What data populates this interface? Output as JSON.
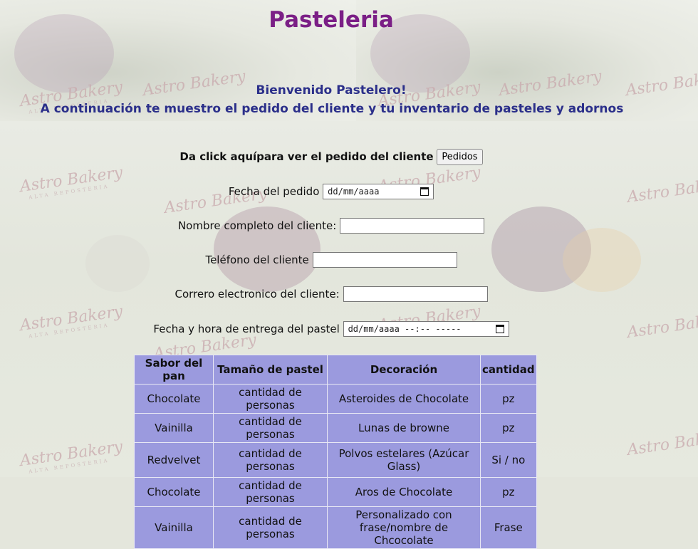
{
  "header": {
    "title": "Pasteleria",
    "welcome": "Bienvenido Pastelero!",
    "intro": "A continuación te muestro el pedido del cliente y tu inventario de pasteles y adornos"
  },
  "form": {
    "orders_prompt": "Da click aquípara ver el pedido del cliente",
    "orders_button": "Pedidos",
    "order_date_label": "Fecha del pedido",
    "order_date_value": "dd/mm/aaaa",
    "name_label": "Nombre completo del cliente:",
    "name_value": "",
    "phone_label": "Teléfono del cliente",
    "phone_value": "",
    "email_label": "Correro electronico del cliente:",
    "email_value": "",
    "delivery_label": "Fecha y hora de entrega del pastel",
    "delivery_value": "dd/mm/aaaa --:-- -----"
  },
  "table": {
    "headers": [
      "Sabor del pan",
      "Tamaño de pastel",
      "Decoración",
      "cantidad"
    ],
    "rows": [
      [
        "Chocolate",
        "cantidad de personas",
        "Asteroides de Chocolate",
        "pz"
      ],
      [
        "Vainilla",
        "cantidad de personas",
        "Lunas de browne",
        "pz"
      ],
      [
        "Redvelvet",
        "cantidad de personas",
        "Polvos estelares (Azúcar Glass)",
        "Si / no"
      ],
      [
        "Chocolate",
        "cantidad de personas",
        "Aros de Chocolate",
        "pz"
      ],
      [
        "Vainilla",
        "cantidad de personas",
        "Personalizado con frase/nombre de Chcocolate",
        "Frase"
      ]
    ]
  },
  "watermark": {
    "brand": "Astro Bakery",
    "tagline": "ALTA REPOSTERIA"
  },
  "colors": {
    "title": "#7b1f86",
    "intro_text": "#2b2f8a",
    "table_bg": "#9b9ade"
  }
}
